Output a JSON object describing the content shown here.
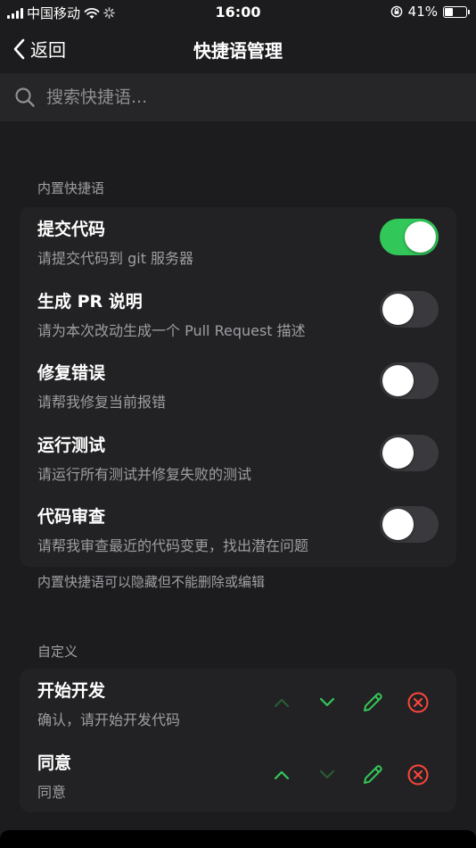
{
  "status_bar": {
    "carrier": "中国移动",
    "time": "16:00",
    "battery_percent": "41%",
    "battery_level": 0.41
  },
  "nav": {
    "back_label": "返回",
    "title": "快捷语管理"
  },
  "search": {
    "placeholder": "搜索快捷语..."
  },
  "builtin": {
    "header": "内置快捷语",
    "footer": "内置快捷语可以隐藏但不能删除或编辑",
    "items": [
      {
        "title": "提交代码",
        "subtitle": "请提交代码到 git 服务器",
        "enabled": true
      },
      {
        "title": "生成 PR 说明",
        "subtitle": "请为本次改动生成一个 Pull Request 描述",
        "enabled": false
      },
      {
        "title": "修复错误",
        "subtitle": "请帮我修复当前报错",
        "enabled": false
      },
      {
        "title": "运行测试",
        "subtitle": "请运行所有测试并修复失败的测试",
        "enabled": false
      },
      {
        "title": "代码审查",
        "subtitle": "请帮我审查最近的代码变更，找出潜在问题",
        "enabled": false
      }
    ]
  },
  "custom": {
    "header": "自定义",
    "items": [
      {
        "title": "开始开发",
        "subtitle": "确认，请开始开发代码",
        "can_move_up": false,
        "can_move_down": true
      },
      {
        "title": "同意",
        "subtitle": "同意",
        "can_move_up": true,
        "can_move_down": false
      }
    ]
  },
  "colors": {
    "background": "#1c1c1e",
    "card": "#222224",
    "toggle_on": "#32c759",
    "toggle_off": "#3a3a3e",
    "accent_green": "#34c759",
    "delete_red": "#ff453a"
  }
}
